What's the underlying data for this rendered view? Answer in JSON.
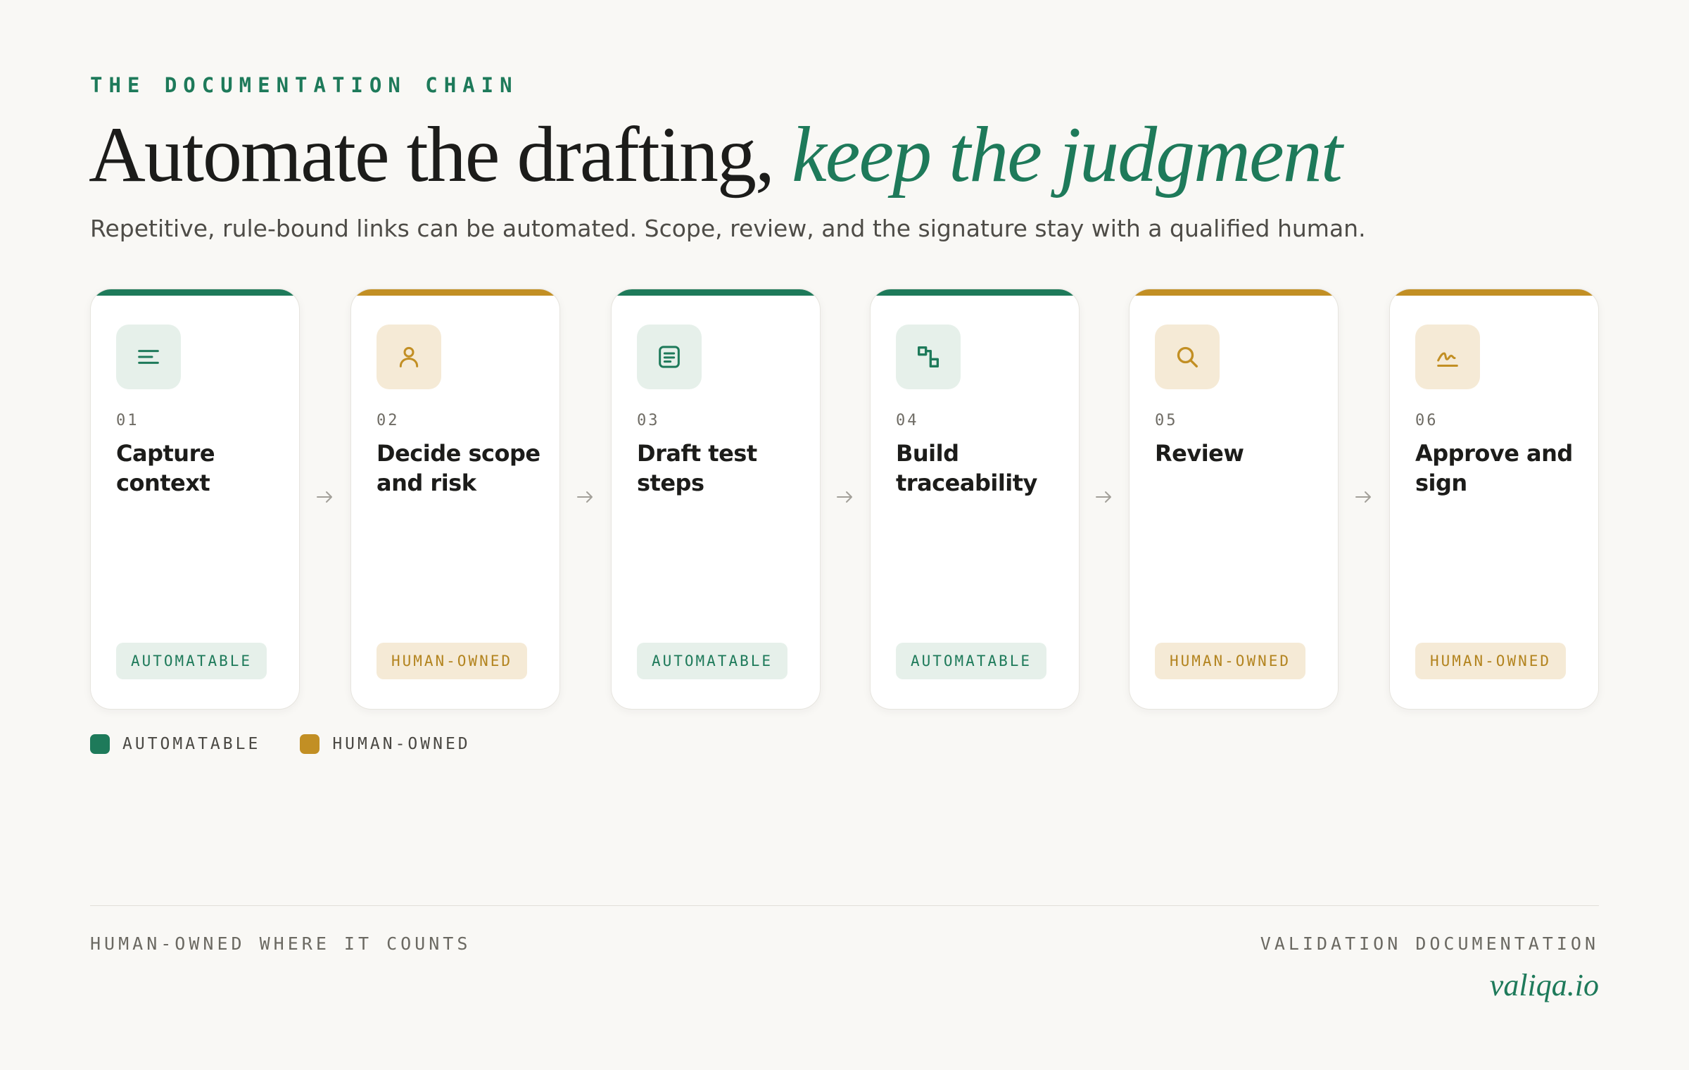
{
  "header": {
    "eyebrow": "THE DOCUMENTATION CHAIN",
    "headline_plain": "Automate the drafting,",
    "headline_accent": "keep the judgment",
    "subhead": "Repetitive, rule-bound links can be automated. Scope, review, and the signature stay with a qualified human."
  },
  "steps": [
    {
      "number": "01",
      "title": "Capture context",
      "owner": "auto",
      "badge": "AUTOMATABLE",
      "icon": "lines-icon"
    },
    {
      "number": "02",
      "title": "Decide scope and risk",
      "owner": "human",
      "badge": "HUMAN-OWNED",
      "icon": "person-icon"
    },
    {
      "number": "03",
      "title": "Draft test steps",
      "owner": "auto",
      "badge": "AUTOMATABLE",
      "icon": "document-icon"
    },
    {
      "number": "04",
      "title": "Build traceability",
      "owner": "auto",
      "badge": "AUTOMATABLE",
      "icon": "link-nodes-icon"
    },
    {
      "number": "05",
      "title": "Review",
      "owner": "human",
      "badge": "HUMAN-OWNED",
      "icon": "search-icon"
    },
    {
      "number": "06",
      "title": "Approve and sign",
      "owner": "human",
      "badge": "HUMAN-OWNED",
      "icon": "signature-icon"
    }
  ],
  "legend": {
    "automatable": "AUTOMATABLE",
    "human_owned": "HUMAN-OWNED"
  },
  "colors": {
    "automatable": "#1e7a5a",
    "human_owned": "#c28f24",
    "background": "#f9f8f5"
  },
  "footer": {
    "left": "HUMAN-OWNED WHERE IT COUNTS",
    "right": "VALIDATION DOCUMENTATION",
    "brand": "valiqa.io"
  }
}
